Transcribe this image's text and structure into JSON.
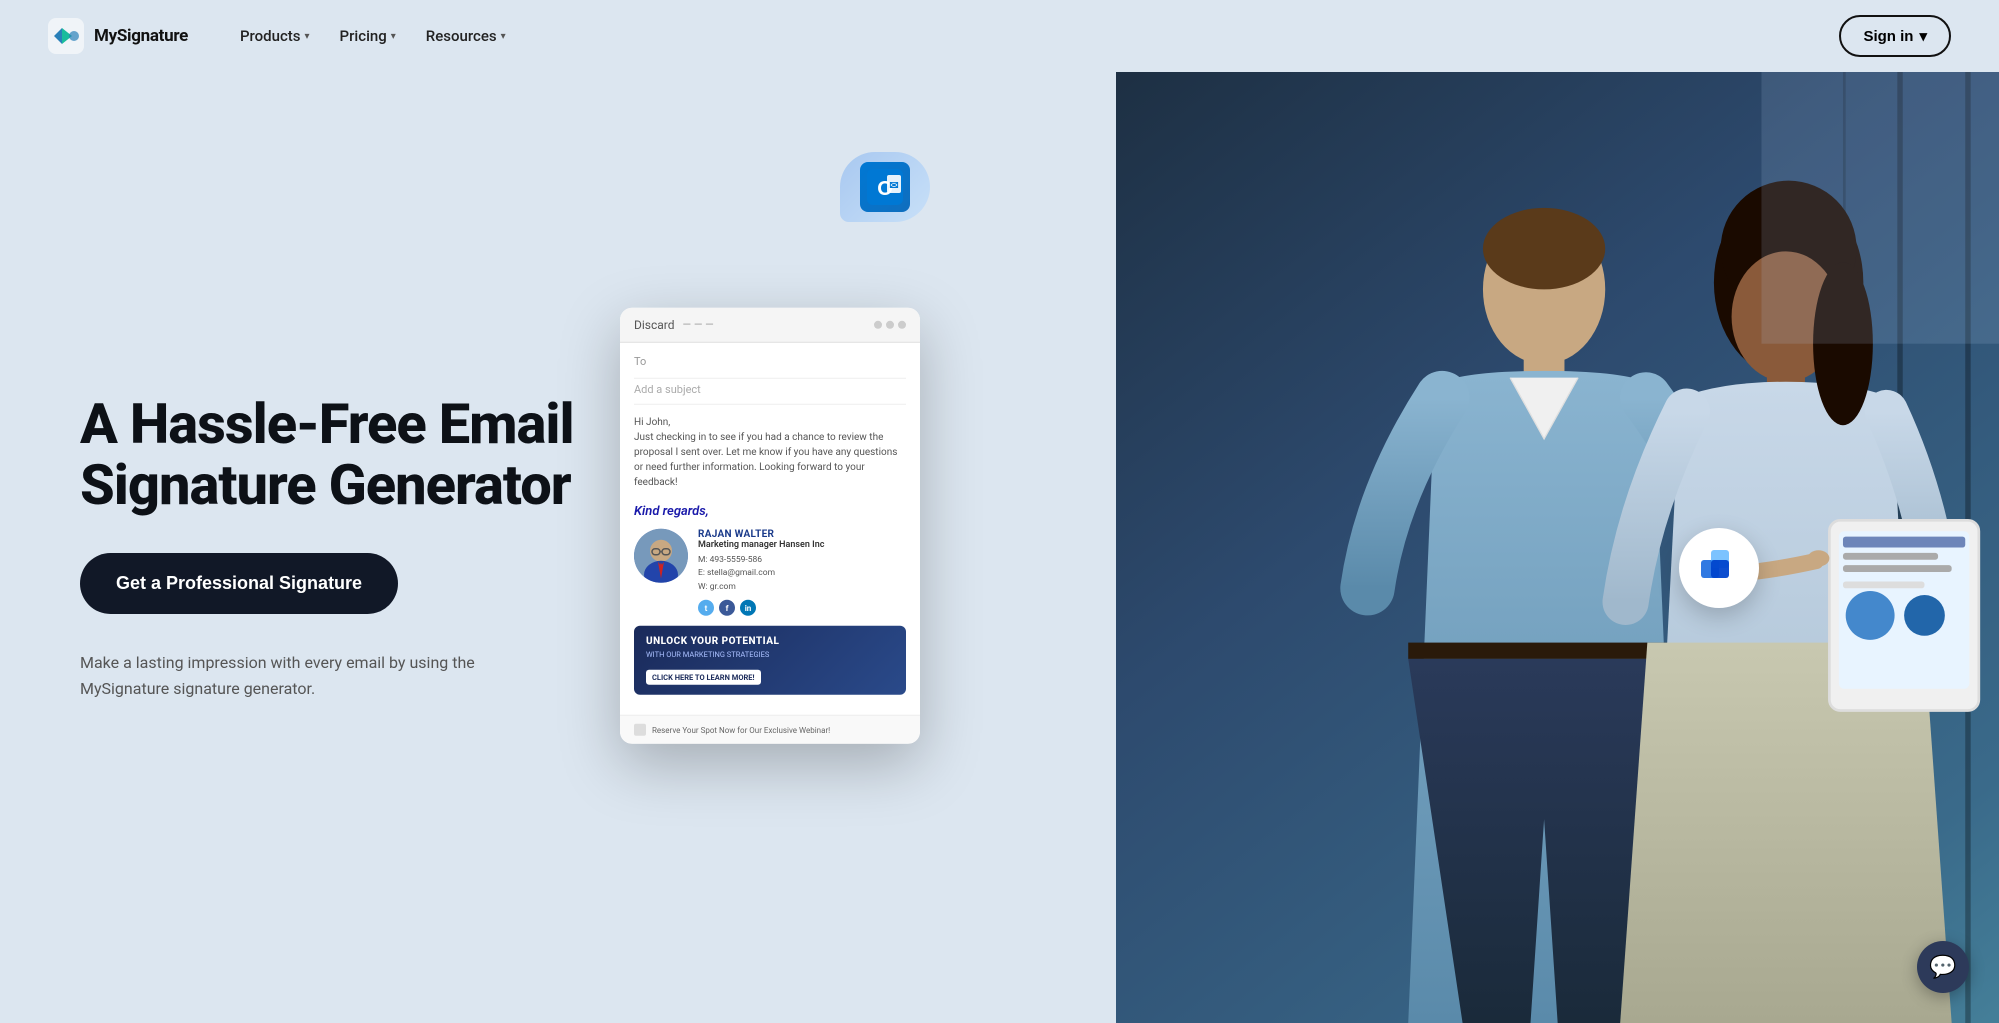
{
  "site": {
    "name": "MySignature",
    "logo_text": "MySignature"
  },
  "nav": {
    "links": [
      {
        "id": "products",
        "label": "Products",
        "has_dropdown": true
      },
      {
        "id": "pricing",
        "label": "Pricing",
        "has_dropdown": true
      },
      {
        "id": "resources",
        "label": "Resources",
        "has_dropdown": true
      }
    ],
    "sign_in": {
      "label": "Sign in",
      "has_dropdown": true
    }
  },
  "hero": {
    "title": "A Hassle-Free Email Signature Generator",
    "cta_label": "Get a Professional Signature",
    "subtitle": "Make a lasting impression with every email by using the MySignature signature generator."
  },
  "signature_card": {
    "header": {
      "discard_label": "Discard",
      "dots": [
        "",
        "",
        ""
      ]
    },
    "to_label": "To",
    "subject_label": "Add a subject",
    "body": "Hi John,\nJust checking in to see if you had a chance to review the proposal I sent over. Let me know if you have any questions or need further information. Looking forward to your feedback!",
    "regards": "Kind regards,",
    "signer": {
      "name": "RAJAN WALTER",
      "title": "Marketing manager Hansen Inc",
      "phone": "M: 493-5559-586",
      "email": "E: stella@gmail.com",
      "website": "W: gr.com"
    },
    "banner": {
      "title": "UNLOCK YOUR POTENTIAL",
      "subtitle": "WITH OUR MARKETING STRATEGIES",
      "cta": "CLICK HERE TO LEARN MORE!"
    },
    "footer_text": "Reserve Your Spot Now for Our Exclusive Webinar!"
  },
  "outlook_icon": "O",
  "chat_icon": "💬"
}
